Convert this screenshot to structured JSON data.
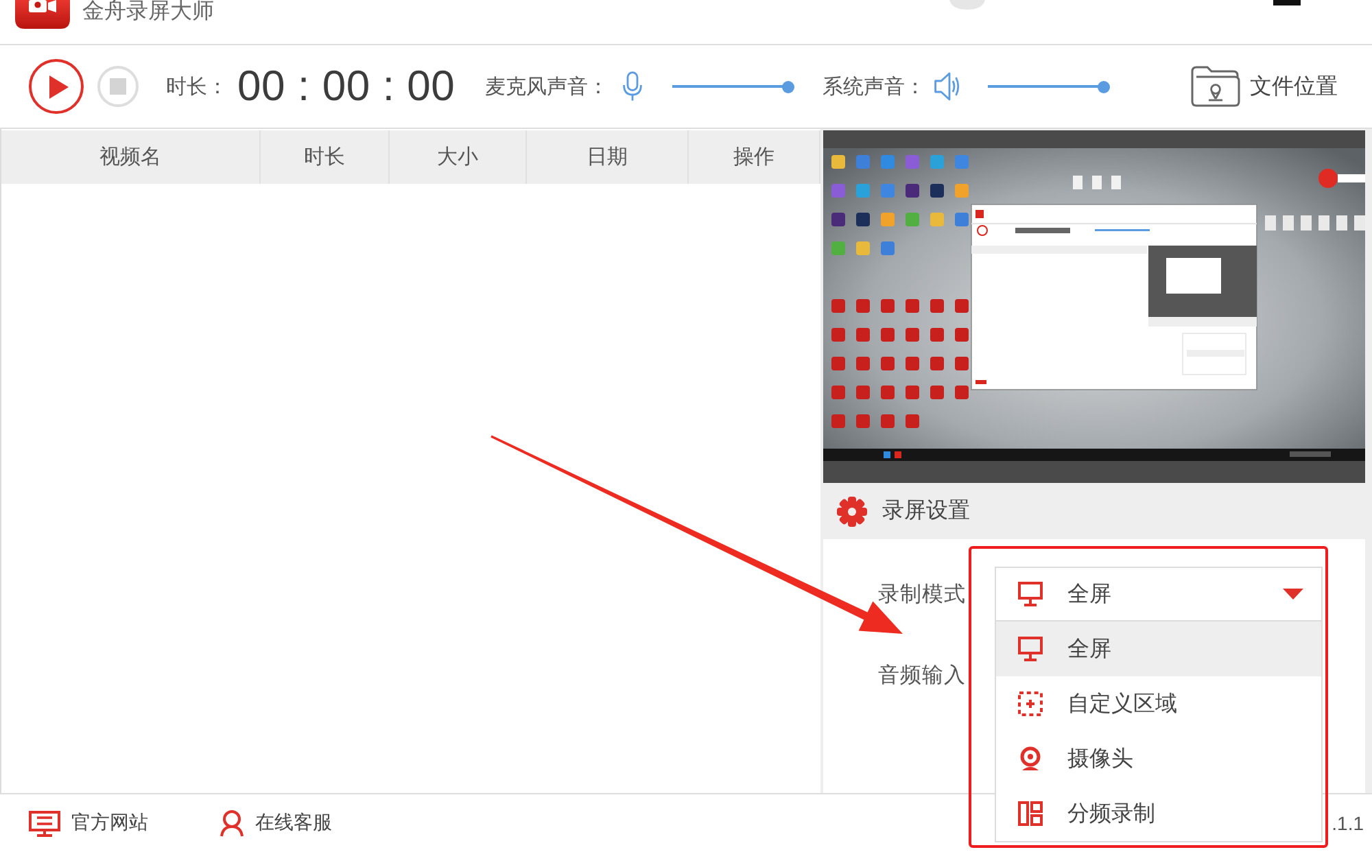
{
  "window": {
    "title": "金舟录屏大师"
  },
  "toolbar": {
    "duration_label": "时长：",
    "timer": "00 : 00 : 00",
    "mic": {
      "label": "麦克风声音：",
      "level": 1
    },
    "system_sound": {
      "label": "系统声音：",
      "level": 1
    },
    "file_location": "文件位置"
  },
  "table": {
    "columns": [
      "视频名",
      "时长",
      "大小",
      "日期",
      "操作"
    ]
  },
  "settings": {
    "title": "录屏设置",
    "rows": [
      {
        "label": "录制模式"
      },
      {
        "label": "音频输入"
      }
    ],
    "mode_select": {
      "value": "全屏",
      "kind": "monitor",
      "expanded": true,
      "options": [
        {
          "label": "全屏",
          "kind": "monitor",
          "selected": true
        },
        {
          "label": "自定义区域",
          "kind": "region",
          "selected": false
        },
        {
          "label": "摄像头",
          "kind": "camera",
          "selected": false
        },
        {
          "label": "分频录制",
          "kind": "split",
          "selected": false
        }
      ]
    }
  },
  "footer": {
    "links": [
      {
        "label": "官方网站",
        "kind": "website"
      },
      {
        "label": "在线客服",
        "kind": "support"
      }
    ],
    "version": ".1.1"
  },
  "annotations": {
    "arrow": true,
    "highlight_box": true
  }
}
